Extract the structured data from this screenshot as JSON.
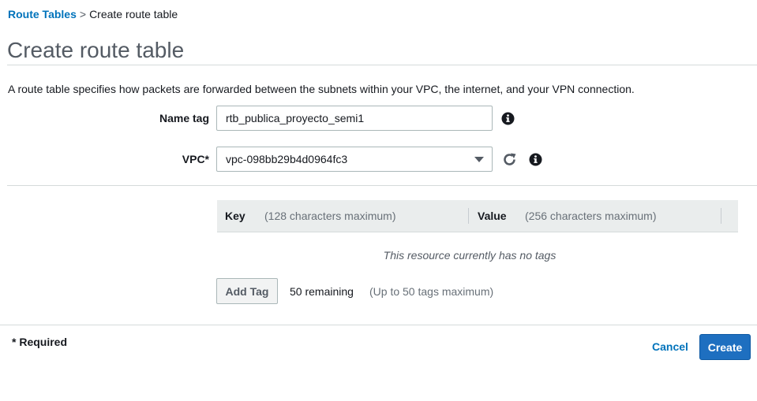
{
  "breadcrumb": {
    "parent": "Route Tables",
    "separator": ">",
    "current": "Create route table"
  },
  "page": {
    "title": "Create route table",
    "description": "A route table specifies how packets are forwarded between the subnets within your VPC, the internet, and your VPN connection."
  },
  "form": {
    "name_tag": {
      "label": "Name tag",
      "value": "rtb_publica_proyecto_semi1",
      "info_icon": "info-icon"
    },
    "vpc": {
      "label": "VPC*",
      "selected": "vpc-098bb29b4d0964fc3",
      "refresh_icon": "refresh-icon",
      "info_icon": "info-icon"
    }
  },
  "tags": {
    "key_header": "Key",
    "key_hint": "(128 characters maximum)",
    "value_header": "Value",
    "value_hint": "(256 characters maximum)",
    "empty_message": "This resource currently has no tags",
    "add_button": "Add Tag",
    "remaining": "50 remaining",
    "max_hint": "(Up to 50 tags maximum)"
  },
  "footer": {
    "required_note": "* Required",
    "cancel_label": "Cancel",
    "create_label": "Create"
  },
  "colors": {
    "link": "#0073bb",
    "primary_button": "#1e6fc0",
    "table_header_bg": "#eaeded"
  }
}
